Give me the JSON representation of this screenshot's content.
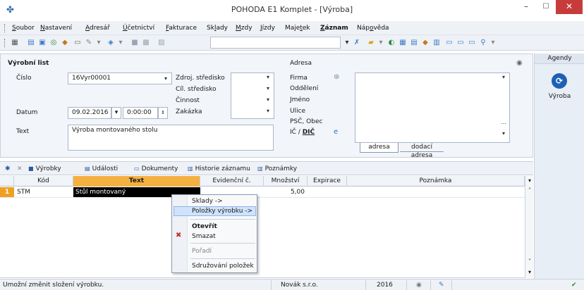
{
  "window": {
    "title": "POHODA E1 Komplet - [Výroba]",
    "min_glyph": "–",
    "max_glyph": "☐",
    "close_glyph": "✕",
    "app_icon_glyph": "✤"
  },
  "menu": [
    {
      "pre": "",
      "u": "S",
      "post": "oubor"
    },
    {
      "pre": "",
      "u": "N",
      "post": "astavení"
    },
    {
      "pre": "",
      "u": "A",
      "post": "dresář"
    },
    {
      "pre": "",
      "u": "Ú",
      "post": "četnictví"
    },
    {
      "pre": "",
      "u": "F",
      "post": "akturace"
    },
    {
      "pre": "Sk",
      "u": "l",
      "post": "ady"
    },
    {
      "pre": "",
      "u": "M",
      "post": "zdy"
    },
    {
      "pre": "",
      "u": "J",
      "post": "ízdy"
    },
    {
      "pre": "Maje",
      "u": "t",
      "post": "ek"
    },
    {
      "pre": "",
      "u": "Z",
      "post": "áznam"
    },
    {
      "pre": "Náp",
      "u": "o",
      "post": "věda"
    }
  ],
  "form": {
    "section_title": "Výrobní list",
    "cislo_label": "Číslo",
    "cislo_value": "16Vyr00001",
    "zdroj_label": "Zdroj. středisko",
    "cil_label": "Cíl. středisko",
    "cinnost_label": "Činnost",
    "zakazka_label": "Zakázka",
    "datum_label": "Datum",
    "datum_value": "09.02.2016",
    "time_value": "0:00:00",
    "text_label": "Text",
    "text_value": "Výroba montovaného stolu",
    "adresa_title": "Adresa",
    "firma_label": "Firma",
    "oddeleni_label": "Oddělení",
    "jmeno_label": "Jméno",
    "ulice_label": "Ulice",
    "psc_label": "PSČ, Obec",
    "ic_label": "IČ / ",
    "dic_label": "DIČ",
    "addr_tab1": "adresa",
    "addr_tab2": "dodací adresa"
  },
  "agenda": {
    "header": "Agendy",
    "item": "Výroba"
  },
  "tabs": [
    {
      "label": "Výrobky",
      "icon": "■"
    },
    {
      "label": "Události",
      "icon": "▤"
    },
    {
      "label": "Dokumenty",
      "icon": "▭"
    },
    {
      "label": "Historie záznamu",
      "icon": "▥"
    },
    {
      "label": "Poznámky",
      "icon": "▥"
    }
  ],
  "grid": {
    "columns": [
      "Kód",
      "Text",
      "Evidenční č.",
      "Množství",
      "Expirace",
      "Poznámka"
    ],
    "rows": [
      {
        "num": "1",
        "kod": "STM",
        "text": "Stůl montovaný",
        "evid": "",
        "mnozstvi": "5,00",
        "expirace": "",
        "poznamka": ""
      }
    ]
  },
  "context_menu": {
    "items": [
      "Sklady ->",
      "Položky výrobku ->",
      "Otevřít",
      "Smazat",
      "Pořadí",
      "Sdružování položek"
    ]
  },
  "status": {
    "hint": "Umožní změnit složení výrobku.",
    "company": "Novák s.r.o.",
    "year": "2016"
  },
  "colors": {
    "close_red": "#c73c3a",
    "selection_black": "#000000",
    "row_number_orange": "#f0a020",
    "text_header_orange": "#f5b042",
    "accent_blue": "#1f5fb6"
  }
}
